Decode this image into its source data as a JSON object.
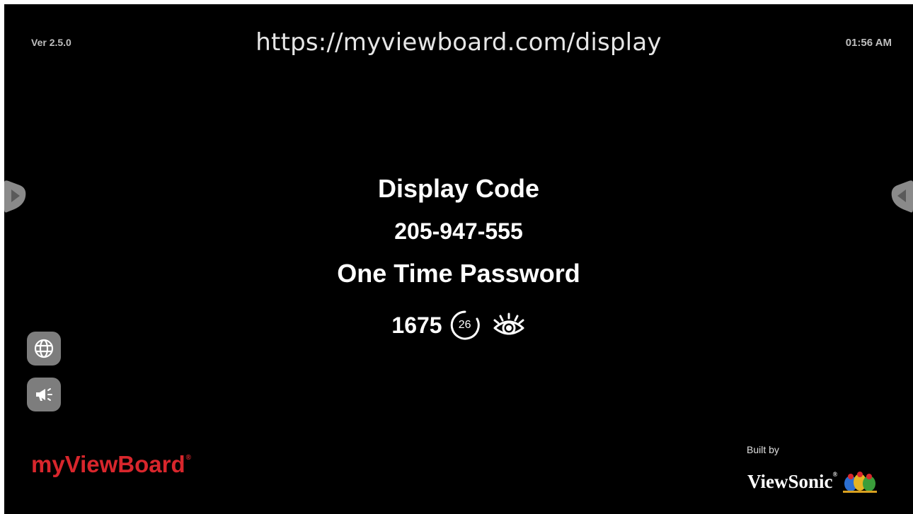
{
  "header": {
    "version": "Ver 2.5.0",
    "url": "https://myviewboard.com/display",
    "time": "01:56 AM"
  },
  "main": {
    "display_code_label": "Display Code",
    "display_code_value": "205-947-555",
    "otp_label": "One Time Password",
    "otp_value": "1675",
    "otp_countdown": "26"
  },
  "icons": {
    "left_tab": "chevron-right-icon",
    "right_tab": "chevron-left-icon",
    "globe": "globe-icon",
    "speaker": "megaphone-icon",
    "countdown": "countdown-timer-icon",
    "eye": "eye-icon"
  },
  "footer": {
    "brand": "myViewBoard",
    "brand_mark": "®",
    "built_by": "Built by",
    "maker": "ViewSonic",
    "maker_mark": "®"
  },
  "colors": {
    "background": "#000000",
    "text": "#ffffff",
    "brand_red": "#d8262c",
    "button_gray": "#7d7d7d"
  }
}
